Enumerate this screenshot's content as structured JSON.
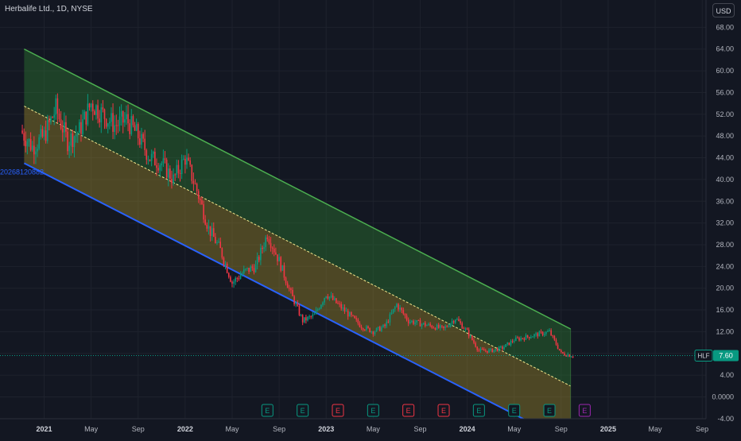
{
  "header": {
    "symbol_label": "Herbalife Ltd., 1D, NYSE",
    "currency": "USD"
  },
  "price_tag": {
    "ticker": "HLF",
    "value": "7.60",
    "color": "#089981"
  },
  "colors": {
    "background": "#131722",
    "up": "#089981",
    "down": "#f23645",
    "upper_band_line": "#4caf50",
    "lower_band_line": "#2962ff",
    "upper_fill": "#2e7d32",
    "lower_fill": "#9e8a2a",
    "mid_line": "#f0e68c"
  },
  "chart_data": {
    "type": "line",
    "subtype": "candlestick with regression channel",
    "title": "Herbalife Ltd., 1D, NYSE",
    "y_axis": {
      "ticks": [
        "68.00",
        "64.00",
        "60.00",
        "56.00",
        "52.00",
        "48.00",
        "44.00",
        "40.00",
        "36.00",
        "32.00",
        "28.00",
        "24.00",
        "20.00",
        "16.00",
        "12.00",
        "8.00",
        "4.00",
        "0.0000",
        "-4.00"
      ],
      "ylim": [
        -4,
        70
      ]
    },
    "x_axis": {
      "ticks": [
        "2021",
        "May",
        "Sep",
        "2022",
        "May",
        "Sep",
        "2023",
        "May",
        "Sep",
        "2024",
        "May",
        "Sep",
        "2025",
        "May",
        "Sep"
      ],
      "range": [
        "2020-11",
        "2025-10"
      ]
    },
    "channel": {
      "upper": {
        "start": [
          "2020-11-10",
          64.0
        ],
        "end": [
          "2024-09-25",
          12.5
        ]
      },
      "middle": {
        "start": [
          "2020-11-10",
          53.5
        ],
        "end": [
          "2024-09-25",
          2.0
        ]
      },
      "lower": {
        "start": [
          "2020-11-10",
          43.0
        ],
        "end": [
          "2024-09-25",
          -8.5
        ]
      },
      "lower_label": "20268120882"
    },
    "series": [
      {
        "values": [
          [
            "2020-11",
            49
          ],
          [
            "2020-12",
            46
          ],
          [
            "2021-01",
            48
          ],
          [
            "2021-02",
            53
          ],
          [
            "2021-03",
            47
          ],
          [
            "2021-04",
            49
          ],
          [
            "2021-05",
            54
          ],
          [
            "2021-06",
            52
          ],
          [
            "2021-07",
            50
          ],
          [
            "2021-08",
            51
          ],
          [
            "2021-09",
            48
          ],
          [
            "2021-10",
            44
          ],
          [
            "2021-11",
            43
          ],
          [
            "2021-12",
            40
          ],
          [
            "2022-01",
            44
          ],
          [
            "2022-02",
            38
          ],
          [
            "2022-03",
            31
          ],
          [
            "2022-04",
            27
          ],
          [
            "2022-05",
            21
          ],
          [
            "2022-06",
            23
          ],
          [
            "2022-07",
            24
          ],
          [
            "2022-08",
            30
          ],
          [
            "2022-09",
            25
          ],
          [
            "2022-10",
            19
          ],
          [
            "2022-11",
            14
          ],
          [
            "2022-12",
            15
          ],
          [
            "2023-01",
            19
          ],
          [
            "2023-02",
            17
          ],
          [
            "2023-03",
            15
          ],
          [
            "2023-04",
            13
          ],
          [
            "2023-05",
            12
          ],
          [
            "2023-06",
            13
          ],
          [
            "2023-07",
            17
          ],
          [
            "2023-08",
            14
          ],
          [
            "2023-09",
            13.5
          ],
          [
            "2023-10",
            13
          ],
          [
            "2023-11",
            12.5
          ],
          [
            "2023-12",
            14.5
          ],
          [
            "2024-01",
            12
          ],
          [
            "2024-02",
            8.5
          ],
          [
            "2024-03",
            8.5
          ],
          [
            "2024-04",
            9
          ],
          [
            "2024-05",
            10.5
          ],
          [
            "2024-06",
            11
          ],
          [
            "2024-07",
            11.5
          ],
          [
            "2024-08",
            12
          ],
          [
            "2024-09",
            8
          ],
          [
            "2024-10",
            7.6
          ]
        ]
      }
    ],
    "earnings_markers": [
      {
        "date": "2022-08",
        "label": "E",
        "kind": "beat"
      },
      {
        "date": "2022-11",
        "label": "E",
        "kind": "beat"
      },
      {
        "date": "2023-02",
        "label": "E",
        "kind": "miss"
      },
      {
        "date": "2023-05",
        "label": "E",
        "kind": "beat"
      },
      {
        "date": "2023-08",
        "label": "E",
        "kind": "miss"
      },
      {
        "date": "2023-11",
        "label": "E",
        "kind": "miss"
      },
      {
        "date": "2024-02",
        "label": "E",
        "kind": "beat"
      },
      {
        "date": "2024-05",
        "label": "E",
        "kind": "beat"
      },
      {
        "date": "2024-08",
        "label": "E",
        "kind": "beat"
      },
      {
        "date": "2024-11",
        "label": "E",
        "kind": "upcoming"
      }
    ],
    "grid": true
  }
}
